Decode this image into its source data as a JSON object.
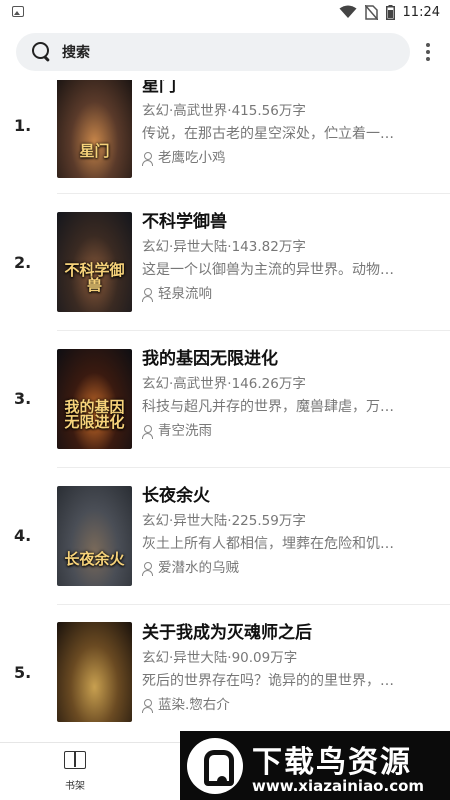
{
  "status_bar": {
    "time": "11:24",
    "icons": [
      "image-icon",
      "wifi-icon",
      "no-sim-icon",
      "battery-icon"
    ]
  },
  "search": {
    "label": "搜索"
  },
  "books": [
    {
      "rank": "1.",
      "title": "星门",
      "meta": "玄幻·高武世界·415.56万字",
      "desc": "传说，在那古老的星空深处，伫立着一…",
      "author": "老鹰吃小鸡",
      "cover_text": "星门",
      "cover_colors": [
        "#1a1412",
        "#5a3a2a",
        "#c9874a"
      ]
    },
    {
      "rank": "2.",
      "title": "不科学御兽",
      "meta": "玄幻·异世大陆·143.82万字",
      "desc": "这是一个以御兽为主流的异世界。动物…",
      "author": "轻泉流响",
      "cover_text": "不科学御兽",
      "cover_colors": [
        "#14161c",
        "#3a2a22",
        "#8a5a3a"
      ]
    },
    {
      "rank": "3.",
      "title": "我的基因无限进化",
      "meta": "玄幻·高武世界·146.26万字",
      "desc": "科技与超凡并存的世界，魔兽肆虐，万…",
      "author": "青空洗雨",
      "cover_text": "我的基因无限进化",
      "cover_colors": [
        "#0e0e12",
        "#3a1a10",
        "#d0702a"
      ]
    },
    {
      "rank": "4.",
      "title": "长夜余火",
      "meta": "玄幻·异世大陆·225.59万字",
      "desc": "灰土上所有人都相信，埋葬在危险和饥…",
      "author": "爱潜水的乌贼",
      "cover_text": "长夜余火",
      "cover_colors": [
        "#2a2e34",
        "#4a4e56",
        "#7a6a5a"
      ]
    },
    {
      "rank": "5.",
      "title": "关于我成为灭魂师之后",
      "meta": "玄幻·异世大陆·90.09万字",
      "desc": "死后的世界存在吗？诡异的的里世界，…",
      "author": "蓝染.惣右介",
      "cover_text": "",
      "cover_colors": [
        "#1a120c",
        "#6a4a22",
        "#c8a050"
      ]
    }
  ],
  "bottom_nav": {
    "shelf_label": "书架"
  },
  "watermark": {
    "title": "下载鸟资源",
    "url": "www.xiazainiao.com"
  }
}
